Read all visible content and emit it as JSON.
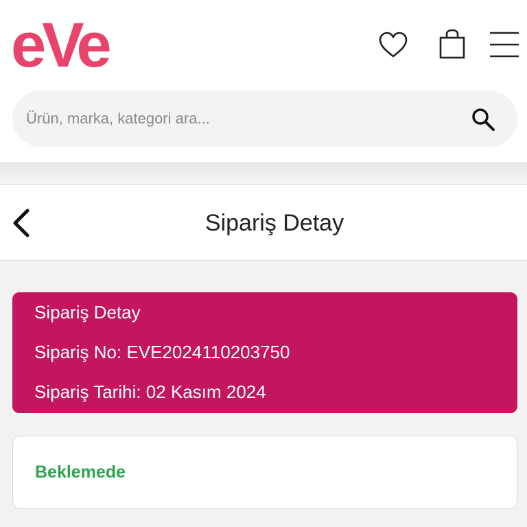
{
  "header": {
    "logo_text": "eVe",
    "brand_color": "#e8436a",
    "icons": [
      "heart-icon",
      "shopping-bag-icon",
      "hamburger-menu-icon"
    ]
  },
  "search": {
    "placeholder": "Ürün, marka, kategori ara...",
    "value": "",
    "icon": "search-icon"
  },
  "titlebar": {
    "title": "Sipariş Detay",
    "back_icon": "chevron-left-icon"
  },
  "order_info": {
    "heading": "Sipariş Detay",
    "order_no": "Sipariş No: EVE2024110203750",
    "order_date": "Sipariş Tarihi: 02 Kasım 2024",
    "background_color": "#c4165e"
  },
  "status": {
    "label": "Beklemede",
    "color": "#2ea44f"
  }
}
